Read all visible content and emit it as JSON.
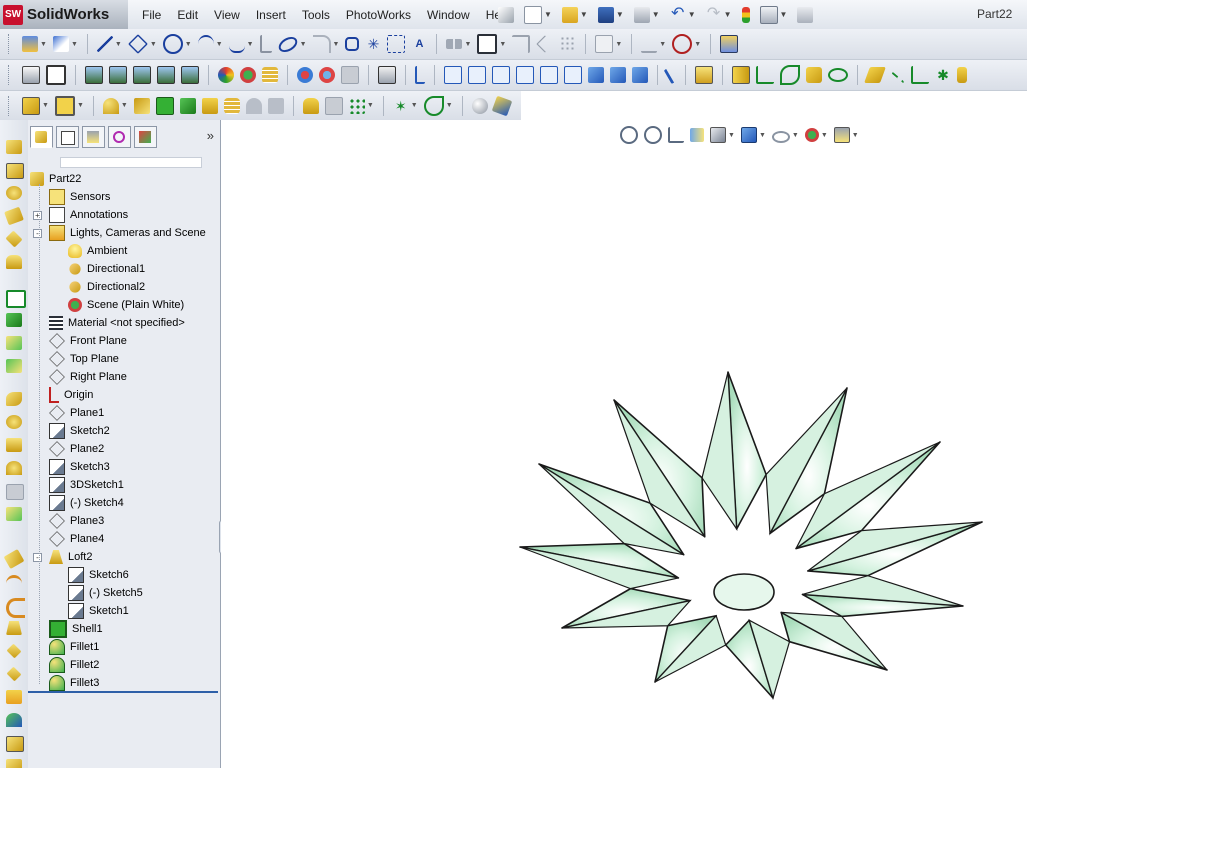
{
  "app": {
    "name": "SolidWorks",
    "logo_mark": "SW"
  },
  "document_title": "Part22",
  "menu": [
    "File",
    "Edit",
    "View",
    "Insert",
    "Tools",
    "PhotoWorks",
    "Window",
    "Help"
  ],
  "quick_access": [
    "pin-icon",
    "new-icon",
    "open-icon",
    "save-icon",
    "print-icon",
    "undo-icon",
    "redo-icon",
    "rebuild-icon",
    "options-icon",
    "screen-capture-icon"
  ],
  "feature_manager": {
    "tabs": [
      "featuremanager-tab",
      "propertymanager-tab",
      "configurationmanager-tab",
      "dimxpert-tab",
      "display-manager-tab"
    ],
    "tree": [
      {
        "label": "Part22",
        "icon": "part-icon",
        "level": 0
      },
      {
        "label": "Sensors",
        "icon": "sensor-icon",
        "level": 1
      },
      {
        "label": "Annotations",
        "icon": "annotation-icon",
        "level": 1,
        "expand": "+"
      },
      {
        "label": "Lights, Cameras and Scene",
        "icon": "lights-icon",
        "level": 1,
        "expand": "-"
      },
      {
        "label": "Ambient",
        "icon": "bulb-icon",
        "level": 2
      },
      {
        "label": "Directional1",
        "icon": "directional-light-icon",
        "level": 2
      },
      {
        "label": "Directional2",
        "icon": "directional-light-icon",
        "level": 2
      },
      {
        "label": "Scene (Plain White)",
        "icon": "scene-icon",
        "level": 2
      },
      {
        "label": "Material <not specified>",
        "icon": "material-icon",
        "level": 1
      },
      {
        "label": "Front Plane",
        "icon": "plane-icon",
        "level": 1
      },
      {
        "label": "Top Plane",
        "icon": "plane-icon",
        "level": 1
      },
      {
        "label": "Right Plane",
        "icon": "plane-icon",
        "level": 1
      },
      {
        "label": "Origin",
        "icon": "origin-icon",
        "level": 1
      },
      {
        "label": "Plane1",
        "icon": "plane-icon",
        "level": 1
      },
      {
        "label": "Sketch2",
        "icon": "sketch-icon",
        "level": 1
      },
      {
        "label": "Plane2",
        "icon": "plane-icon",
        "level": 1
      },
      {
        "label": "Sketch3",
        "icon": "sketch-icon",
        "level": 1
      },
      {
        "label": "3DSketch1",
        "icon": "3dsketch-icon",
        "level": 1
      },
      {
        "label": "(-) Sketch4",
        "icon": "sketch-icon",
        "level": 1
      },
      {
        "label": "Plane3",
        "icon": "plane-icon",
        "level": 1
      },
      {
        "label": "Plane4",
        "icon": "plane-icon",
        "level": 1
      },
      {
        "label": "Loft2",
        "icon": "loft-icon",
        "level": 1,
        "expand": "-"
      },
      {
        "label": "Sketch6",
        "icon": "sketch-icon",
        "level": 2
      },
      {
        "label": "(-) Sketch5",
        "icon": "sketch-icon",
        "level": 2
      },
      {
        "label": "Sketch1",
        "icon": "sketch-icon",
        "level": 2
      },
      {
        "label": "Shell1",
        "icon": "shell-icon",
        "level": 1
      },
      {
        "label": "Fillet1",
        "icon": "fillet-icon",
        "level": 1
      },
      {
        "label": "Fillet2",
        "icon": "fillet-icon",
        "level": 1
      },
      {
        "label": "Fillet3",
        "icon": "fillet-icon",
        "level": 1
      }
    ]
  },
  "colors": {
    "model_fill": "#c8ecd6",
    "model_edge": "#1a1a1a",
    "accent_blue": "#2d5fa8"
  }
}
